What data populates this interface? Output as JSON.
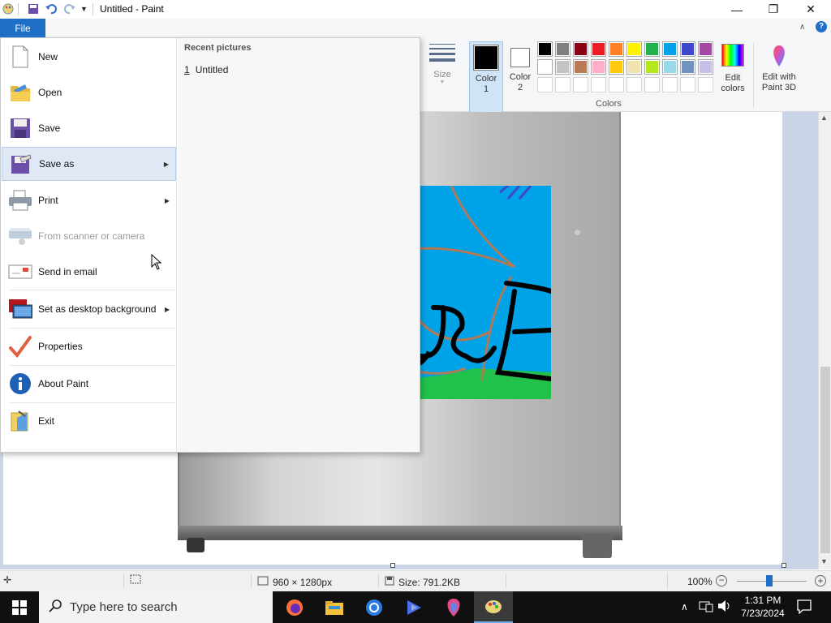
{
  "window": {
    "title": "Untitled - Paint",
    "minimize_label": "—",
    "maximize_label": "❐",
    "close_label": "✕"
  },
  "file_tab": {
    "label": "File"
  },
  "file_menu": {
    "items": [
      {
        "name": "new",
        "label": "New",
        "icon": "new-document-icon",
        "submenu": false,
        "disabled": false
      },
      {
        "name": "open",
        "label": "Open",
        "icon": "open-folder-icon",
        "submenu": false,
        "disabled": false
      },
      {
        "name": "save",
        "label": "Save",
        "icon": "floppy-disk-icon",
        "submenu": false,
        "disabled": false
      },
      {
        "name": "save-as",
        "label": "Save as",
        "icon": "save-as-icon",
        "submenu": true,
        "disabled": false
      },
      {
        "name": "print",
        "label": "Print",
        "icon": "printer-icon",
        "submenu": true,
        "disabled": false
      },
      {
        "name": "from-scanner",
        "label": "From scanner or camera",
        "icon": "scanner-icon",
        "submenu": false,
        "disabled": true
      },
      {
        "name": "send-email",
        "label": "Send in email",
        "icon": "email-icon",
        "submenu": false,
        "disabled": false
      },
      {
        "name": "desktop-background",
        "label": "Set as desktop background",
        "icon": "monitor-icon",
        "submenu": true,
        "disabled": false
      },
      {
        "name": "properties",
        "label": "Properties",
        "icon": "checkmark-icon",
        "submenu": false,
        "disabled": false
      },
      {
        "name": "about",
        "label": "About Paint",
        "icon": "info-icon",
        "submenu": false,
        "disabled": false
      },
      {
        "name": "exit",
        "label": "Exit",
        "icon": "exit-icon",
        "submenu": false,
        "disabled": false
      }
    ],
    "recent_header": "Recent pictures",
    "recent": [
      {
        "num": "1",
        "name": "Untitled"
      }
    ]
  },
  "ribbon": {
    "size_label": "Size",
    "color1_label": "Color\n1",
    "color2_label": "Color\n2",
    "edit_colors_label": "Edit\ncolors",
    "paint3d_label": "Edit with\nPaint 3D",
    "colors_group_label": "Colors",
    "color1_value": "#000000",
    "color2_value": "#ffffff",
    "palette_row1": [
      "#000000",
      "#7f7f7f",
      "#880015",
      "#ed1c24",
      "#ff7f27",
      "#fff200",
      "#22b14c",
      "#00a2e8",
      "#3f48cc",
      "#a349a4"
    ],
    "palette_row2": [
      "#ffffff",
      "#c3c3c3",
      "#b97a57",
      "#ffaec9",
      "#ffc90e",
      "#efe4b0",
      "#b5e61d",
      "#99d9ea",
      "#7092be",
      "#c8bfe7"
    ],
    "palette_row3": [
      "",
      "",
      "",
      "",
      "",
      "",
      "",
      "",
      "",
      ""
    ]
  },
  "status": {
    "dimensions": "960 × 1280px",
    "size": "Size: 791.2KB",
    "zoom": "100%",
    "zoom_level_percent": 100
  },
  "taskbar": {
    "search_placeholder": "Type here to search",
    "time": "1:31 PM",
    "date": "7/23/2024"
  }
}
